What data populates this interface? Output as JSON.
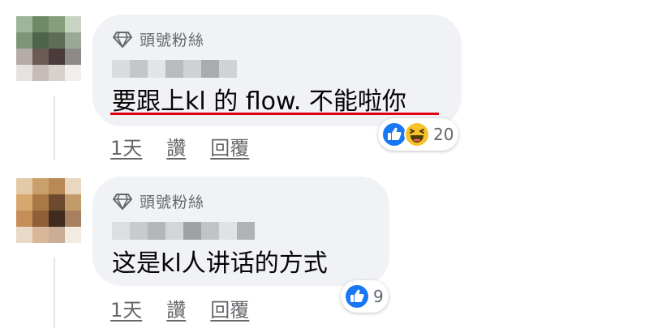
{
  "comments": [
    {
      "badge_label": "頭號粉絲",
      "text": "要跟上kl 的 flow. 不能啦你",
      "reactions": {
        "icons": [
          "like-icon",
          "haha-icon"
        ],
        "count": "20"
      },
      "actions": {
        "time": "1天",
        "like": "讚",
        "reply": "回覆"
      }
    },
    {
      "badge_label": "頭號粉絲",
      "text": "这是kl人讲话的方式",
      "reactions": {
        "icons": [
          "like-icon"
        ],
        "count": "9"
      },
      "actions": {
        "time": "1天",
        "like": "讚",
        "reply": "回覆"
      }
    }
  ],
  "colors": {
    "bubble": "#f0f2f5",
    "secondary_text": "#65676b",
    "underline_highlight": "#e0000f",
    "like_blue": "#1877f2",
    "haha_yellow": "#f7c12b"
  }
}
